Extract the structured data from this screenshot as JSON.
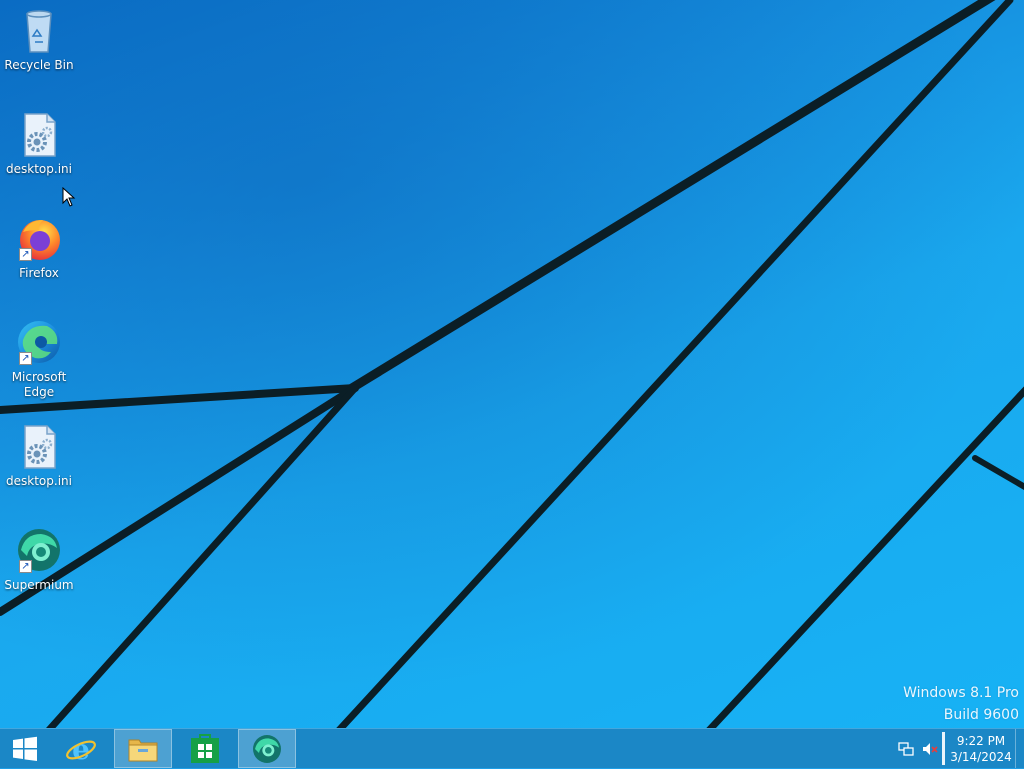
{
  "desktop": {
    "icons": [
      {
        "label": "Recycle Bin",
        "icon": "recycle-bin-icon"
      },
      {
        "label": "desktop.ini",
        "icon": "settings-file-icon"
      },
      {
        "label": "Firefox",
        "icon": "firefox-icon",
        "shortcut": true
      },
      {
        "label": "Microsoft Edge",
        "icon": "edge-icon",
        "shortcut": true
      },
      {
        "label": "desktop.ini",
        "icon": "settings-file-icon"
      },
      {
        "label": "Supermium",
        "icon": "supermium-icon",
        "shortcut": true
      }
    ],
    "watermark": {
      "edition": "Windows 8.1 Pro",
      "build": "Build 9600"
    }
  },
  "taskbar": {
    "start_icon": "windows-logo-icon",
    "apps": [
      {
        "name": "Internet Explorer",
        "icon": "internet-explorer-icon"
      },
      {
        "name": "File Explorer",
        "icon": "file-explorer-icon"
      },
      {
        "name": "Store",
        "icon": "store-icon"
      },
      {
        "name": "Supermium",
        "icon": "supermium-icon",
        "active": true
      }
    ],
    "tray": {
      "network_icon": "network-icon",
      "volume_icon": "volume-muted-icon",
      "clock_time": "9:22 PM",
      "clock_date": "3/14/2024"
    }
  },
  "colors": {
    "taskbar": "#1b87c6",
    "wallpaper_base": "#1aa8ee",
    "wallpaper_lines": "#0b1e26"
  }
}
